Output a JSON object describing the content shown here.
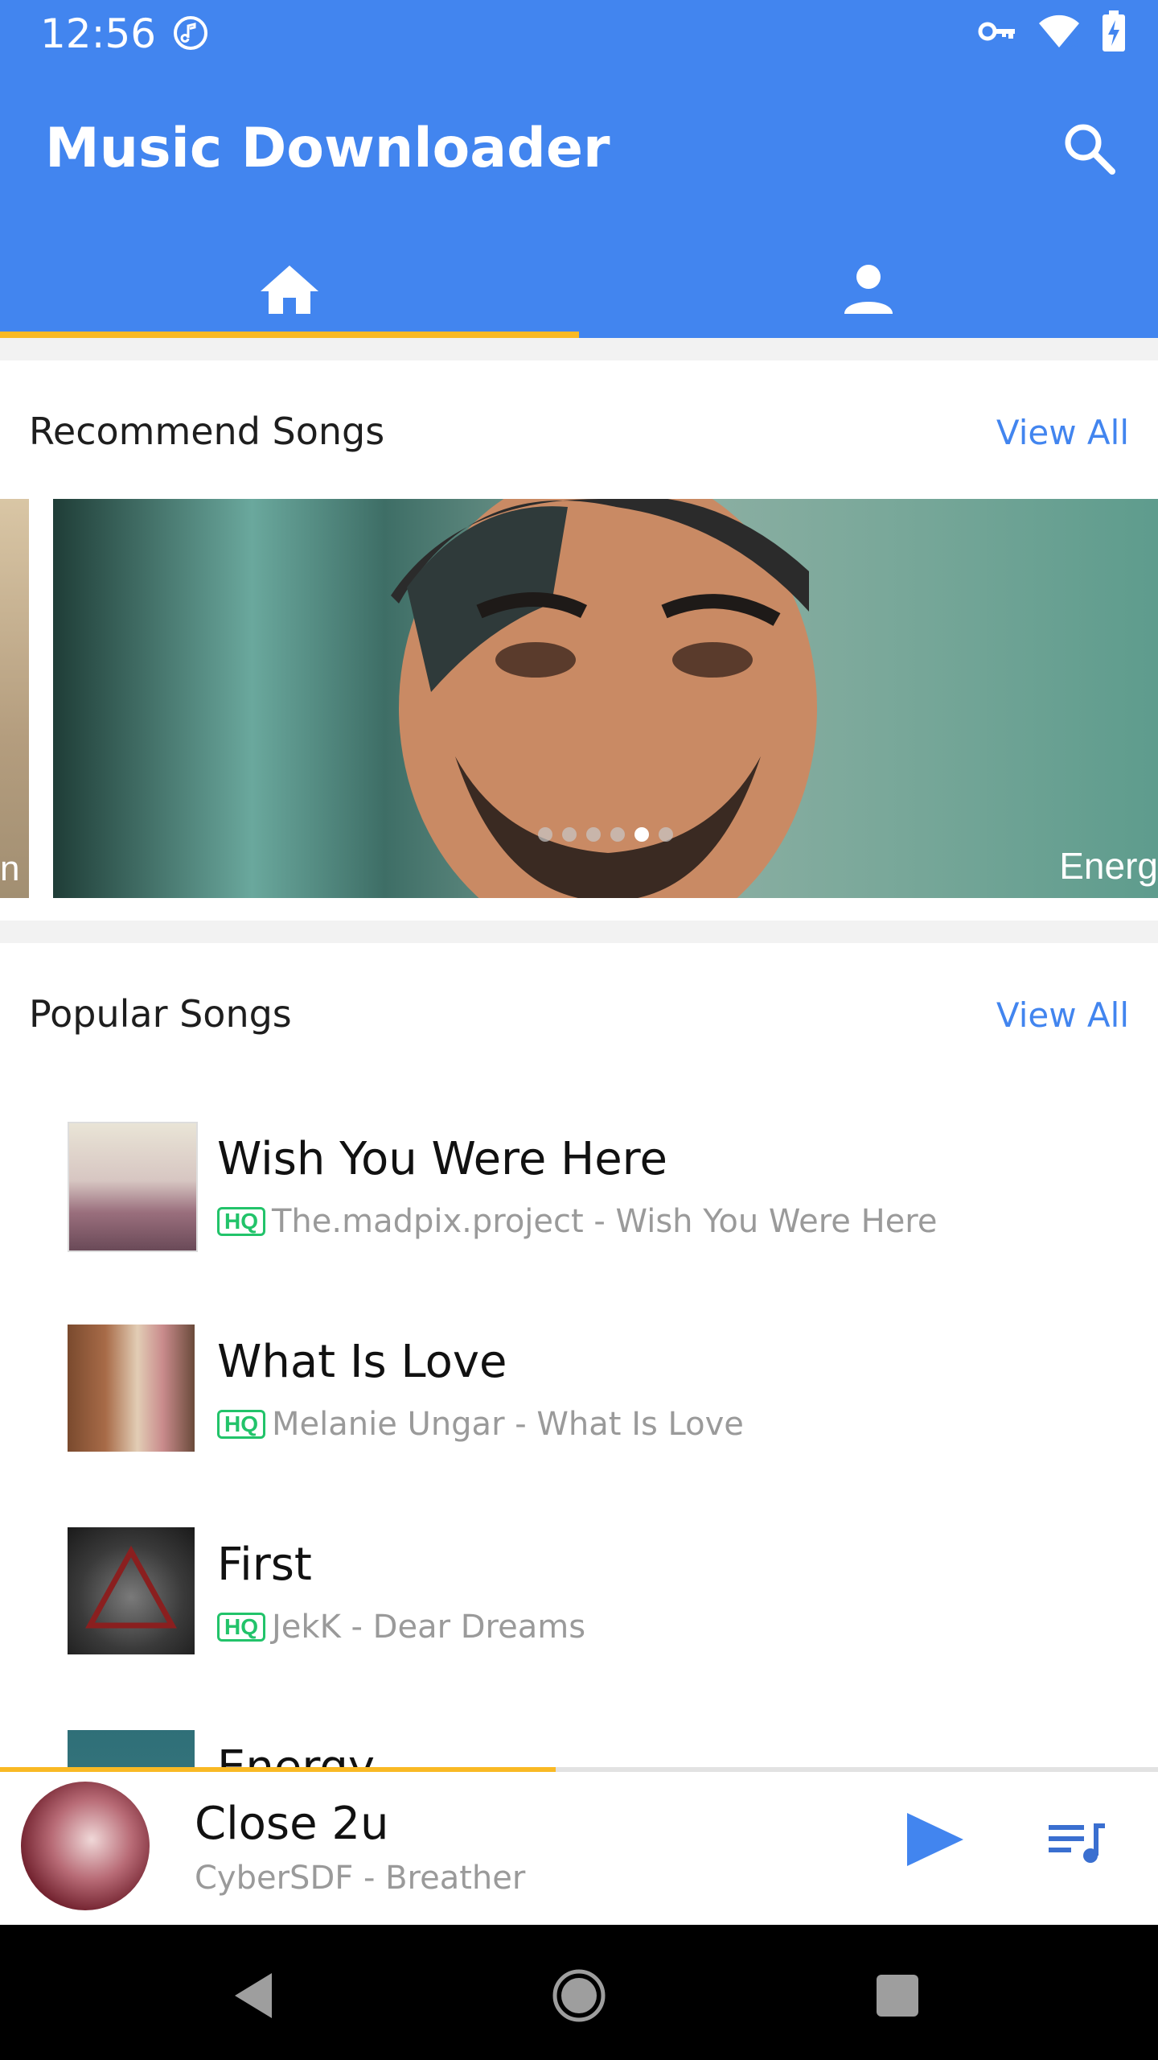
{
  "status_bar": {
    "time": "12:56",
    "icons": [
      "music-note-icon",
      "vpn-key-icon",
      "wifi-icon",
      "battery-charging-icon"
    ]
  },
  "app_bar": {
    "title": "Music Downloader",
    "search_icon": "search-icon",
    "color": "#4285ef"
  },
  "tabs": [
    {
      "icon": "home-icon",
      "selected": true
    },
    {
      "icon": "person-icon",
      "selected": false
    }
  ],
  "accent_color": "#f9b924",
  "recommend": {
    "title": "Recommend Songs",
    "view_all": "View All",
    "prev_caption": "n",
    "main_caption": "Energ",
    "dots_total": 6,
    "dots_active_index": 4
  },
  "popular": {
    "title": "Popular Songs",
    "view_all": "View All",
    "hq_label": "HQ",
    "songs": [
      {
        "title": "Wish You Were Here",
        "subtitle": "The.madpix.project - Wish You Were Here"
      },
      {
        "title": "What Is Love",
        "subtitle": "Melanie Ungar - What Is Love"
      },
      {
        "title": "First",
        "subtitle": "JekK - Dear Dreams"
      },
      {
        "title": "Energy"
      }
    ]
  },
  "now_playing": {
    "title": "Close 2u",
    "artist": "CyberSDF - Breather",
    "progress": 0.48,
    "play_icon": "play-icon",
    "queue_icon": "playlist-icon"
  },
  "nav_bar": {
    "icons": [
      "back-icon",
      "home-circle-icon",
      "recents-icon"
    ]
  }
}
